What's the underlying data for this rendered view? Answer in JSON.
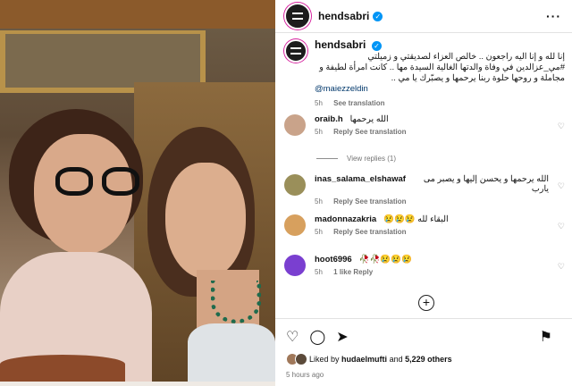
{
  "post": {
    "username": "hendsabri",
    "caption_lines": [
      "إنا لله و إنا اليه راجعون .. خالص العزاء لصديقتي و زميلتي",
      "#مي_عزالدين في وفاة والدتها الغالية السيدة مها .. كانت امرأة لطيفة و",
      "مجاملة و روحها حلوة ربنا يرحمها و يصبّرك يا مي .."
    ],
    "mention": "@maiezzeldin",
    "caption_time": "5h",
    "see_translation": "See translation"
  },
  "comments": [
    {
      "username": "oraib.h",
      "text": "الله يرحمها",
      "time": "5h",
      "reply": "Reply",
      "translate": "See translation",
      "avatar_color": "#c9a38a"
    },
    {
      "username": "inas_salama_elshawaf",
      "text": "الله يرحمها و يحسن إليها و يصبر مى يارب",
      "time": "5h",
      "reply": "Reply",
      "translate": "See translation",
      "avatar_color": "#9a8f5a"
    },
    {
      "username": "madonnazakria",
      "text": "البقاء لله 😢😢😢",
      "time": "5h",
      "reply": "Reply",
      "translate": "See translation",
      "avatar_color": "#d7a05e"
    },
    {
      "username": "hoot6996",
      "text": "🥀🥀😢😢😢",
      "time": "5h",
      "likes": "1 like",
      "reply": "Reply",
      "avatar_color": "#7a3fd0"
    }
  ],
  "view_replies": "View replies (1)",
  "footer": {
    "liked_by_prefix": "Liked by",
    "liked_by_user": "hudaelmufti",
    "and": "and",
    "others": "5,229 others",
    "posted": "5 hours ago"
  },
  "icons": {
    "more": "more-options-icon",
    "heart": "heart-icon",
    "comment": "comment-icon",
    "share": "share-icon",
    "bookmark": "bookmark-icon",
    "add": "add-comment-icon"
  }
}
